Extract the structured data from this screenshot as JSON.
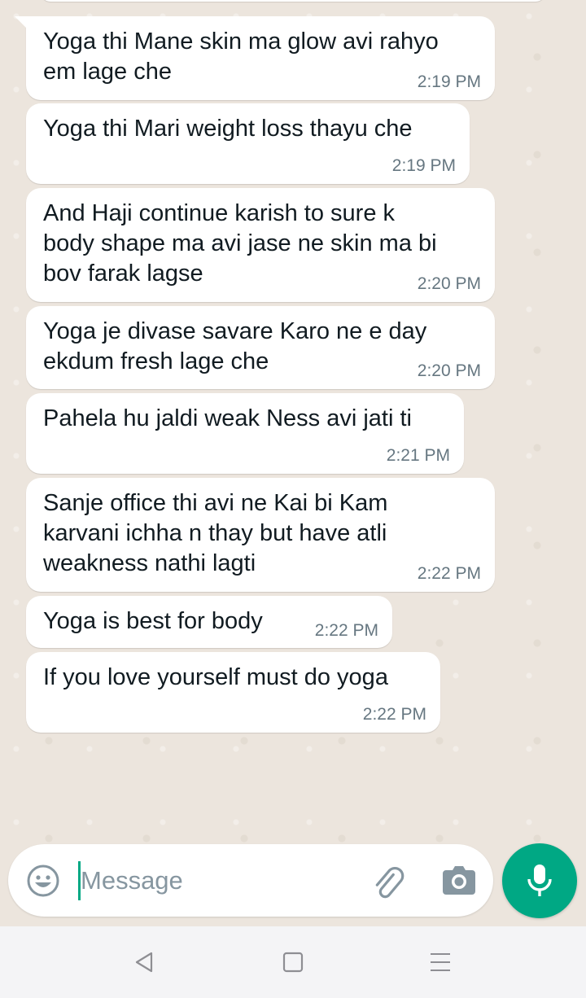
{
  "messages": [
    {
      "text": "Yoga thi Mane skin ma glow avi rahyo\nem lage che",
      "time": "2:19 PM"
    },
    {
      "text": "Yoga thi Mari weight loss thayu che",
      "time": "2:19 PM"
    },
    {
      "text": "And Haji continue karish to sure k\nbody shape ma avi jase ne skin ma bi\nbov farak lagse",
      "time": "2:20 PM"
    },
    {
      "text": "Yoga je divase savare Karo ne e day\nekdum fresh lage che",
      "time": "2:20 PM"
    },
    {
      "text": "Pahela hu jaldi weak Ness avi jati ti",
      "time": "2:21 PM"
    },
    {
      "text": "Sanje office thi avi ne Kai bi Kam\nkarvani ichha n thay but have atli\nweakness nathi lagti",
      "time": "2:22 PM"
    },
    {
      "text": "Yoga is best for body",
      "time": "2:22 PM"
    },
    {
      "text": "If you love yourself must do yoga",
      "time": "2:22 PM"
    }
  ],
  "composer": {
    "placeholder": "Message",
    "value": ""
  },
  "icons": {
    "emoji": "emoji-icon",
    "attach": "paperclip-icon",
    "camera": "camera-icon",
    "mic": "microphone-icon",
    "nav_back": "back-triangle-icon",
    "nav_home": "home-square-icon",
    "nav_menu": "menu-lines-icon"
  },
  "colors": {
    "chat_background": "#ece5dd",
    "bubble": "#ffffff",
    "accent": "#00a884",
    "timestamp": "#667781",
    "nav_bar": "#f4f4f6"
  }
}
